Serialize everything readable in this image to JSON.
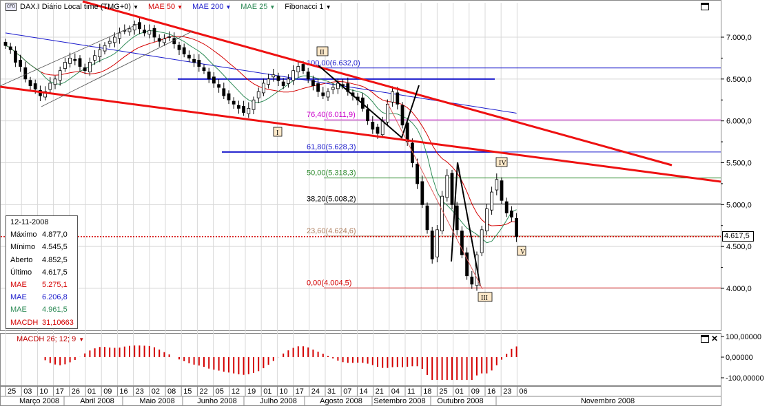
{
  "header": {
    "instrument_badge": "CFD",
    "instrument": "DAX.I Diário Local time (TMG+0)",
    "indicators": [
      {
        "label": "MAE 50",
        "color": "#d40000"
      },
      {
        "label": "MAE 200",
        "color": "#1a1acc"
      },
      {
        "label": "MAE 25",
        "color": "#2e8b57"
      },
      {
        "label": "Fibonacci 1",
        "color": "#000000"
      }
    ]
  },
  "info_panel": {
    "date": "12-11-2008",
    "rows": [
      {
        "label": "Máximo",
        "value": "4.877,0",
        "color": "#000000"
      },
      {
        "label": "Mínimo",
        "value": "4.545,5",
        "color": "#000000"
      },
      {
        "label": "Aberto",
        "value": "4.852,5",
        "color": "#000000"
      },
      {
        "label": "Último",
        "value": "4.617,5",
        "color": "#000000"
      },
      {
        "label": "MAE",
        "value": "5.275,1",
        "color": "#d40000"
      },
      {
        "label": "MAE",
        "value": "6.206,8",
        "color": "#1a1acc"
      },
      {
        "label": "MAE",
        "value": "4.961,5",
        "color": "#2e8b57"
      },
      {
        "label": "MACDH",
        "value": "31,10663",
        "color": "#d40000"
      }
    ]
  },
  "macd_panel": {
    "label": "MACDH 26; 12; 9",
    "ticks": [
      "100,00000",
      "0,00000",
      "-100,00000"
    ]
  },
  "current_price": "4.617,5",
  "colors": {
    "bull": "#ffffff",
    "bear": "#000000",
    "trend": "#ee1111",
    "grid": "#d8d8d8"
  },
  "chart_data": {
    "type": "candlestick",
    "ylim": [
      3500,
      7400
    ],
    "y_ticks": [
      4000,
      4500,
      5000,
      5500,
      6000,
      6500,
      7000
    ],
    "y_tick_labels": [
      "4.000,0",
      "4.500,0",
      "5.000,0",
      "5.500,0",
      "6.000,0",
      "6.500,0",
      "7.000,0"
    ],
    "x_day_labels": [
      "25",
      "03",
      "10",
      "17",
      "26",
      "01",
      "09",
      "16",
      "23",
      "02",
      "08",
      "15",
      "22",
      "05",
      "12",
      "19",
      "01",
      "10",
      "17",
      "24",
      "31",
      "07",
      "14",
      "21",
      "04",
      "11",
      "18",
      "25",
      "01",
      "09",
      "16",
      "23",
      "06"
    ],
    "x_month_labels": [
      "Março 2008",
      "Abril 2008",
      "Maio 2008",
      "Junho 2008",
      "Julho 2008",
      "Agosto 2008",
      "Setembro 2008",
      "Outubro 2008",
      "Novembro 2008"
    ],
    "fibonacci": [
      {
        "label": "100,00(6.632,0)",
        "value": 6632.0,
        "color": "#1a1acc"
      },
      {
        "label": "76,40(6.011,9)",
        "value": 6011.9,
        "color": "#cc00cc"
      },
      {
        "label": "61,80(5.628,3)",
        "value": 5628.3,
        "color": "#1a1acc"
      },
      {
        "label": "50,00(5.318,3)",
        "value": 5318.3,
        "color": "#2e8b2e"
      },
      {
        "label": "38,20(5.008,2)",
        "value": 5008.2,
        "color": "#000000"
      },
      {
        "label": "23,60(4.624,6)",
        "value": 4624.6,
        "color": "#b08060"
      },
      {
        "label": "0,00(4.004,5)",
        "value": 4004.5,
        "color": "#d40000"
      }
    ],
    "wave_labels": [
      "I",
      "II",
      "III",
      "IV",
      "V"
    ],
    "series": [
      {
        "name": "MAE 50",
        "color": "#d40000"
      },
      {
        "name": "MAE 200",
        "color": "#1a1acc"
      },
      {
        "name": "MAE 25",
        "color": "#2e8b57"
      }
    ],
    "closes": [
      6900,
      6850,
      6700,
      6650,
      6500,
      6420,
      6380,
      6300,
      6350,
      6450,
      6500,
      6600,
      6700,
      6750,
      6720,
      6650,
      6600,
      6700,
      6780,
      6850,
      6900,
      6950,
      7000,
      7050,
      7080,
      7100,
      7150,
      7100,
      7050,
      7080,
      7000,
      6950,
      6980,
      7000,
      6920,
      6850,
      6800,
      6750,
      6700,
      6650,
      6600,
      6500,
      6450,
      6400,
      6300,
      6250,
      6200,
      6150,
      6100,
      6150,
      6250,
      6350,
      6450,
      6500,
      6550,
      6480,
      6420,
      6500,
      6600,
      6650,
      6600,
      6500,
      6420,
      6350,
      6300,
      6350,
      6400,
      6450,
      6420,
      6350,
      6300,
      6250,
      6150,
      6000,
      5900,
      5850,
      6000,
      6200,
      6350,
      6200,
      5950,
      5750,
      5500,
      5250,
      5000,
      4700,
      4350,
      4700,
      5100,
      5350,
      5000,
      4700,
      4400,
      4150,
      4050,
      4400,
      4700,
      4950,
      5150,
      5300,
      5050,
      4900,
      4850,
      4617
    ]
  }
}
